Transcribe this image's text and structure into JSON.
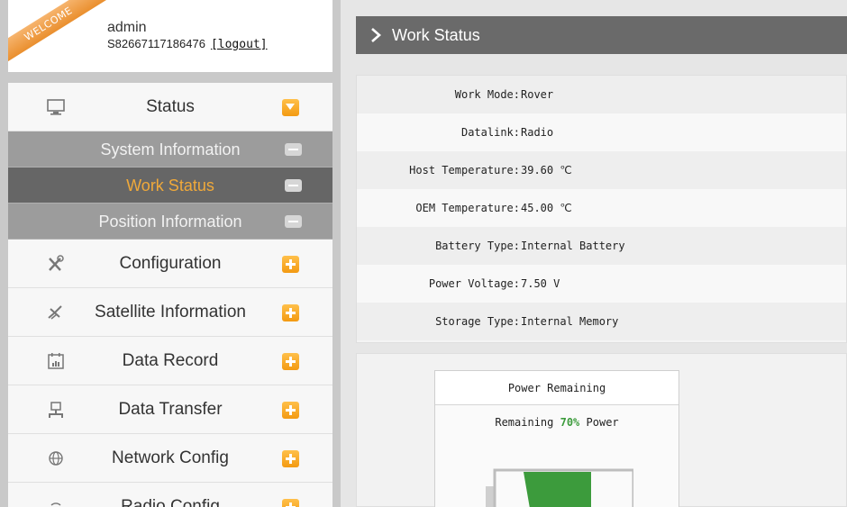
{
  "user": {
    "welcome_badge": "WELCOME",
    "username": "admin",
    "serial": "S82667117186476",
    "logout_label": "[logout]"
  },
  "menu": {
    "status": {
      "label": "Status",
      "icon": "monitor-icon",
      "state": "expanded"
    },
    "status_sub": [
      {
        "label": "System Information"
      },
      {
        "label": "Work Status",
        "active": true
      },
      {
        "label": "Position Information"
      }
    ],
    "items": [
      {
        "label": "Configuration",
        "icon": "tools-icon"
      },
      {
        "label": "Satellite Information",
        "icon": "satellite-icon"
      },
      {
        "label": "Data Record",
        "icon": "calendar-chart-icon"
      },
      {
        "label": "Data Transfer",
        "icon": "network-computer-icon"
      },
      {
        "label": "Network Config",
        "icon": "globe-icon"
      },
      {
        "label": "Radio Config",
        "icon": "radio-icon"
      }
    ]
  },
  "page": {
    "title": "Work Status"
  },
  "work_status": {
    "rows": [
      {
        "label": "Work Mode:",
        "value": "Rover"
      },
      {
        "label": "Datalink:",
        "value": "Radio"
      },
      {
        "label": "Host Temperature:",
        "value": "39.60 ℃"
      },
      {
        "label": "OEM Temperature:",
        "value": "45.00 ℃"
      },
      {
        "label": "Battery Type:",
        "value": "Internal Battery"
      },
      {
        "label": "Power Voltage:",
        "value": "7.50 V"
      },
      {
        "label": "Storage Type:",
        "value": "Internal Memory"
      }
    ]
  },
  "power": {
    "header": "Power Remaining",
    "prefix": "Remaining",
    "percent_text": "70%",
    "suffix": "Power",
    "level": 0.7
  },
  "colors": {
    "accent_orange": "#f39a12",
    "active_sub_text": "#f0a93a",
    "battery_green": "#3c9b3c"
  }
}
